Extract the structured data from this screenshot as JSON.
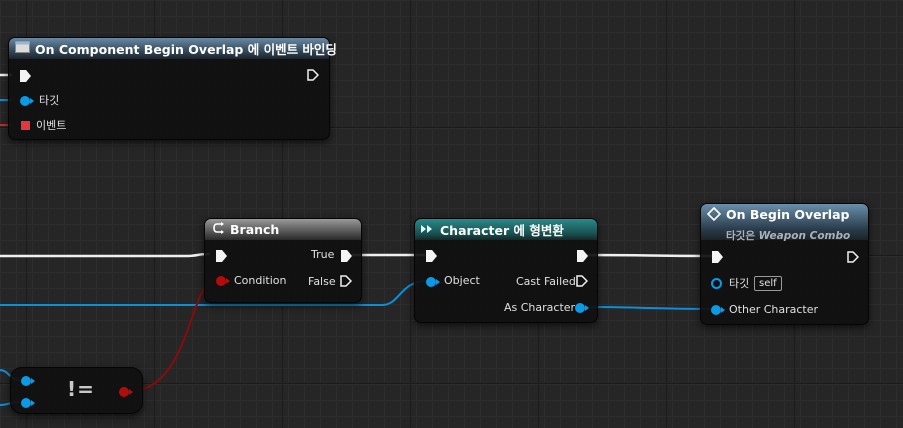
{
  "colors": {
    "exec": "#f4f4f4",
    "object": "#0b9be6",
    "bool": "#b30c0c",
    "delegate": "#e8343c"
  },
  "bind_node": {
    "title": "On Component Begin Overlap 에 이벤트 바인딩",
    "icon": "function-icon",
    "target_label": "타깃",
    "event_label": "이벤트"
  },
  "branch_node": {
    "title": "Branch",
    "icon": "branch-icon",
    "condition_label": "Condition",
    "true_label": "True",
    "false_label": "False"
  },
  "cast_node": {
    "title": "Character 에 형변환",
    "icon": "cast-icon",
    "object_label": "Object",
    "cast_failed_label": "Cast Failed",
    "as_character_label": "As Character"
  },
  "overlap_node": {
    "title": "On Begin Overlap",
    "icon": "event-diamond-icon",
    "subtitle_prefix": "타깃은",
    "subtitle_target": "Weapon Combo",
    "target_label": "타깃",
    "self_label": "self",
    "other_label": "Other Character"
  },
  "not_equal_node": {
    "symbol": "!="
  }
}
